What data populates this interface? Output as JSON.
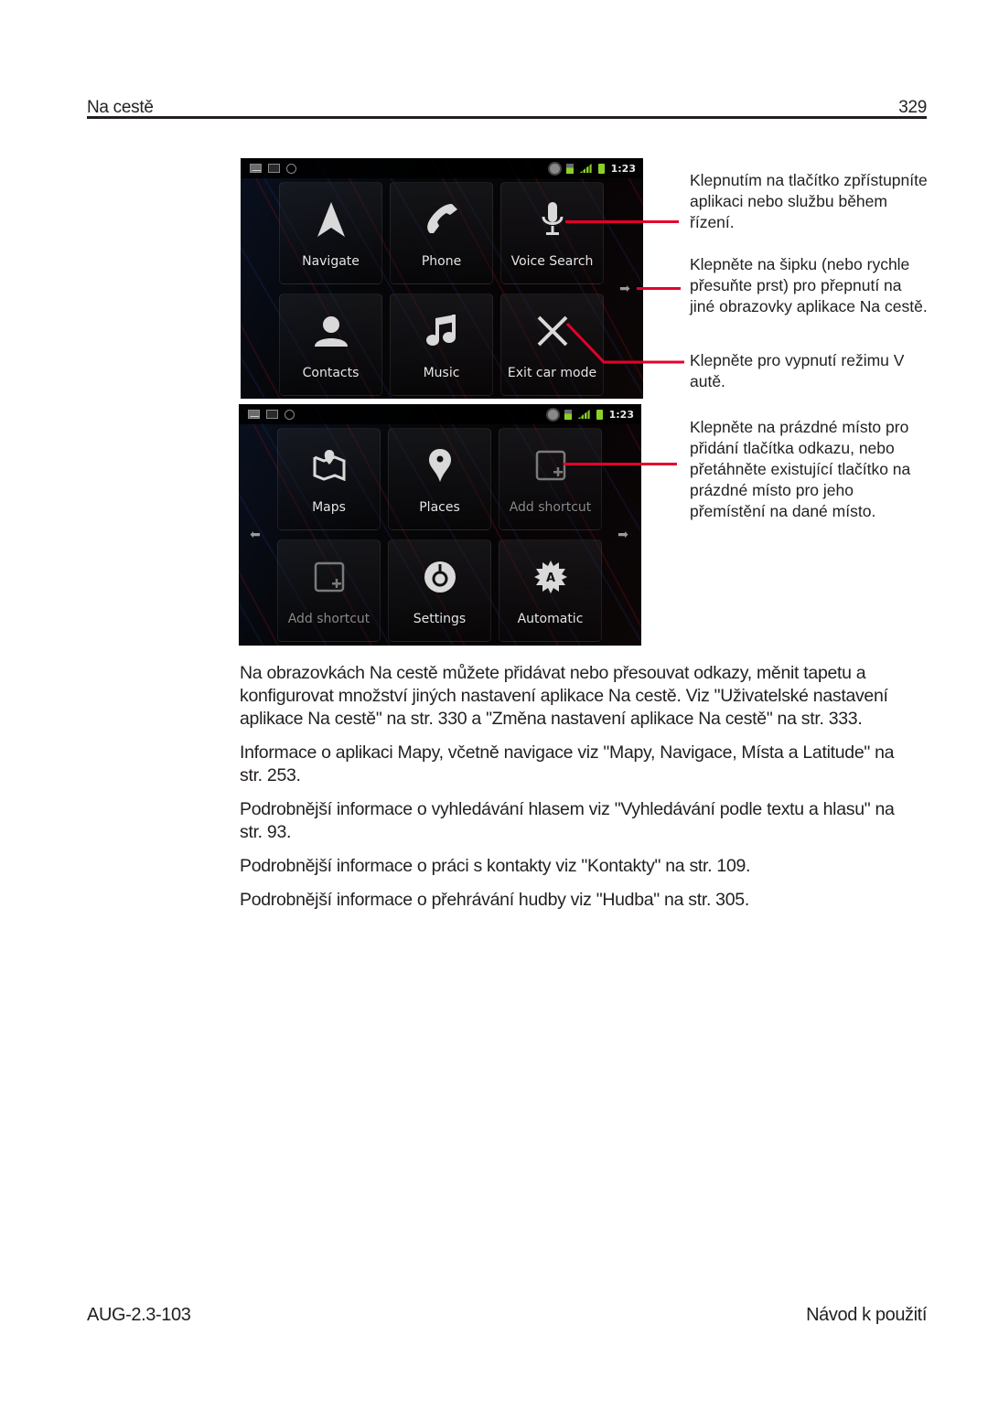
{
  "header": {
    "section_title": "Na cestě",
    "page_number": "329"
  },
  "screens": [
    {
      "status_bar": {
        "left_icons": [
          "gmail-icon",
          "calendar-icon",
          "car-mode-icon"
        ],
        "right_icons": [
          "gps-icon",
          "3g-data-icon",
          "signal-icon",
          "battery-icon"
        ],
        "time": "1:23"
      },
      "tiles": [
        {
          "label": "Navigate",
          "icon": "navigate-arrow-icon"
        },
        {
          "label": "Phone",
          "icon": "phone-icon"
        },
        {
          "label": "Voice Search",
          "icon": "microphone-icon"
        },
        {
          "label": "Contacts",
          "icon": "contacts-icon"
        },
        {
          "label": "Music",
          "icon": "music-icon"
        },
        {
          "label": "Exit car mode",
          "icon": "exit-x-icon"
        }
      ],
      "arrows": [
        "right"
      ]
    },
    {
      "status_bar": {
        "left_icons": [
          "gmail-icon",
          "calendar-icon",
          "car-mode-icon"
        ],
        "right_icons": [
          "gps-icon",
          "3g-data-icon",
          "signal-icon",
          "battery-icon"
        ],
        "time": "1:23"
      },
      "tiles": [
        {
          "label": "Maps",
          "icon": "maps-icon"
        },
        {
          "label": "Places",
          "icon": "places-pin-icon"
        },
        {
          "label": "Add shortcut",
          "icon": "add-shortcut-icon"
        },
        {
          "label": "Add shortcut",
          "icon": "add-shortcut-icon"
        },
        {
          "label": "Settings",
          "icon": "settings-icon"
        },
        {
          "label": "Automatic",
          "icon": "automatic-icon"
        }
      ],
      "arrows": [
        "left",
        "right"
      ]
    }
  ],
  "callouts": [
    "Klepnutím na tlačítko zpřístupníte aplikaci nebo službu během řízení.",
    "Klepněte na šipku (nebo rychle přesuňte prst) pro přepnutí na jiné obrazovky aplikace Na cestě.",
    "Klepněte pro vypnutí režimu V autě.",
    "Klepněte na prázdné místo pro přidání tlačítka odkazu, nebo přetáhněte existující tlačítko na prázdné místo pro jeho přemístění na dané místo."
  ],
  "callout_color": "#e4002b",
  "paragraphs": [
    "Na obrazovkách Na cestě můžete přidávat nebo přesouvat odkazy, měnit tapetu a konfigurovat množství jiných nastavení aplikace Na cestě. Viz \"Uživatelské nastavení aplikace Na cestě\" na str. 330 a \"Změna nastavení aplikace Na cestě\" na str. 333.",
    "Informace o aplikaci Mapy, včetně navigace viz \"Mapy, Navigace, Místa a Latitude\" na str. 253.",
    "Podrobnější informace o vyhledávání hlasem viz \"Vyhledávání podle textu a hlasu\" na str. 93.",
    "Podrobnější informace o práci s kontakty viz \"Kontakty\" na str. 109.",
    "Podrobnější informace o přehrávání hudby viz \"Hudba\" na str. 305."
  ],
  "footer": {
    "doc_code": "AUG-2.3-103",
    "doc_title": "Návod k použití"
  }
}
